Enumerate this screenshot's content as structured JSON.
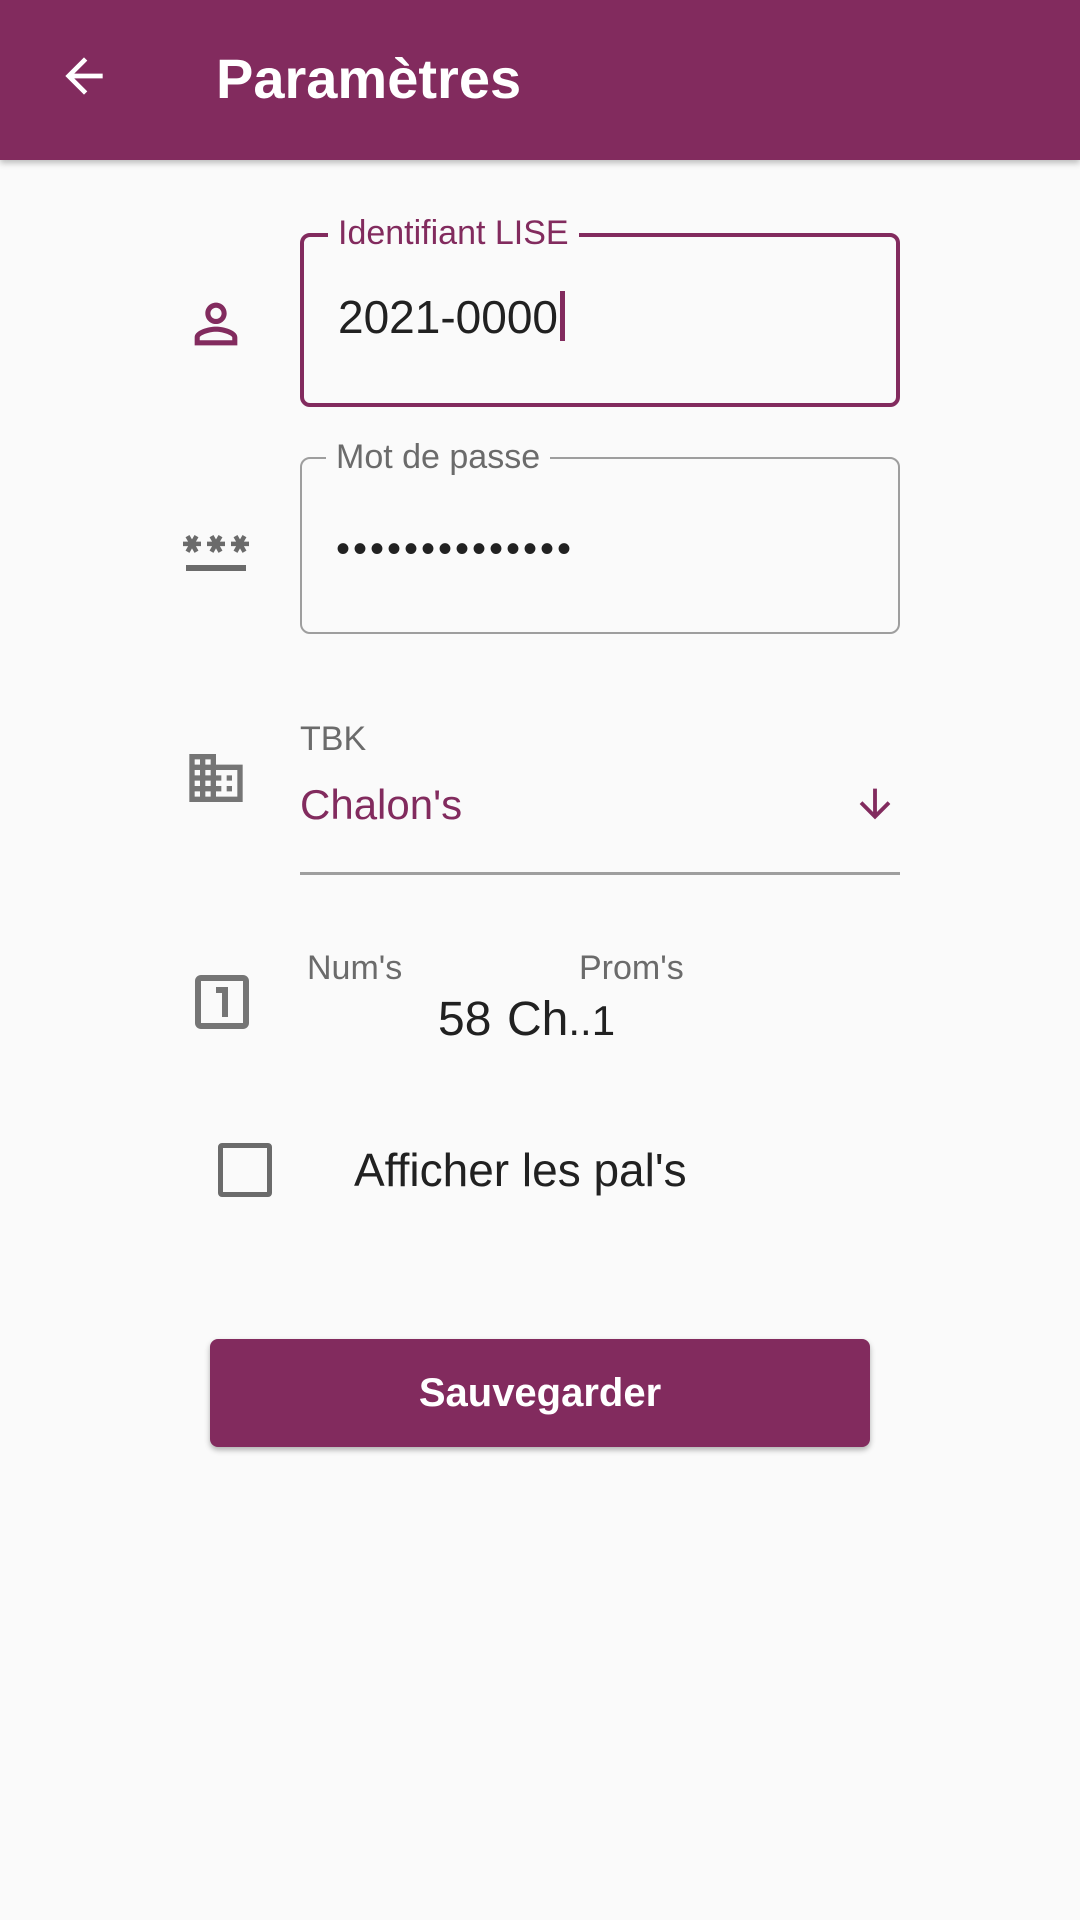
{
  "appbar": {
    "title": "Paramètres",
    "back_icon": "arrow-back-icon"
  },
  "form": {
    "username": {
      "label": "Identifiant LISE",
      "value": "2021-0000",
      "icon": "person-icon",
      "state": "focused"
    },
    "password": {
      "label": "Mot de passe",
      "value": "••••••••••••••",
      "icon": "password-icon"
    },
    "tbk": {
      "label": "TBK",
      "value": "Chalon's",
      "icon": "building-icon",
      "arrow_icon": "arrow-down-icon"
    },
    "picker": {
      "icon": "looks-one-icon",
      "num_label": "Num's",
      "prom_label": "Prom's",
      "num_value": "58",
      "prom_value": "Ch",
      "prom_suffix": "..1"
    },
    "show_pals": {
      "label": "Afficher les pal's",
      "checked": false
    },
    "save_button": "Sauvegarder"
  },
  "colors": {
    "primary": "#822b5e",
    "background": "#fafafa",
    "muted": "#6b6b6b",
    "text": "#212121"
  }
}
